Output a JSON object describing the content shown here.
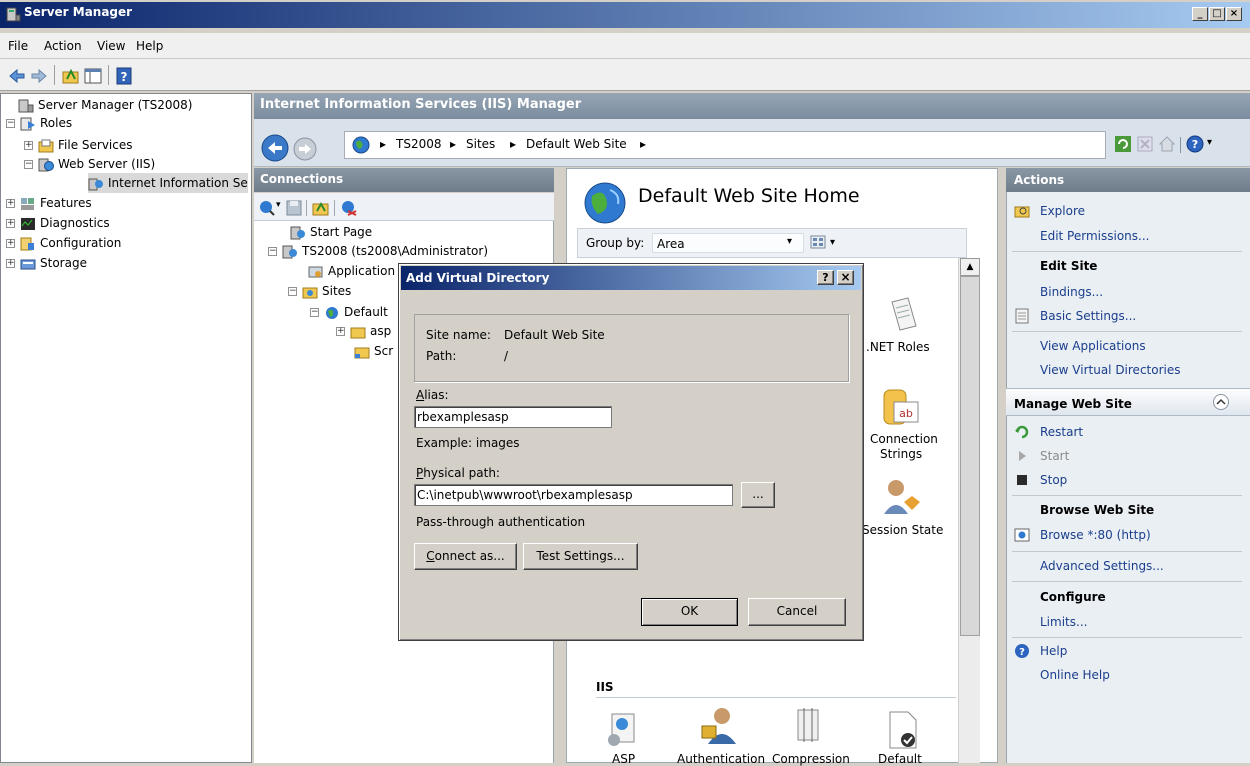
{
  "window": {
    "title": "Server Manager"
  },
  "menu": [
    "File",
    "Action",
    "View",
    "Help"
  ],
  "left_tree": {
    "root": "Server Manager (TS2008)",
    "roles": "Roles",
    "file_services": "File Services",
    "web_server": "Web Server (IIS)",
    "iis_manager": "Internet Information Se",
    "features": "Features",
    "diagnostics": "Diagnostics",
    "configuration": "Configuration",
    "storage": "Storage"
  },
  "iis": {
    "header": "Internet Information Services (IIS) Manager",
    "breadcrumb": [
      "TS2008",
      "Sites",
      "Default Web Site"
    ]
  },
  "connections": {
    "header": "Connections",
    "start_page": "Start Page",
    "server": "TS2008 (ts2008\\Administrator)",
    "app_pools": "Application",
    "sites": "Sites",
    "default_site": "Default",
    "child1": "asp",
    "child2": "Scr"
  },
  "center": {
    "title": "Default Web Site Home",
    "group_by_label": "Group by:",
    "group_by_value": "Area",
    "features": {
      "net_roles": ".NET Roles",
      "connection_strings": [
        "Connection",
        "Strings"
      ],
      "session_state": "Session State"
    },
    "iis_section": "IIS",
    "iis_features": [
      "ASP",
      "Authentication",
      "Compression",
      "Default"
    ]
  },
  "actions": {
    "header": "Actions",
    "explore": "Explore",
    "edit_permissions": "Edit Permissions...",
    "edit_site": "Edit Site",
    "bindings": "Bindings...",
    "basic_settings": "Basic Settings...",
    "view_applications": "View Applications",
    "view_virtual_dirs": "View Virtual Directories",
    "manage_site": "Manage Web Site",
    "restart": "Restart",
    "start": "Start",
    "stop": "Stop",
    "browse_site": "Browse Web Site",
    "browse": "Browse *:80 (http)",
    "advanced_settings": "Advanced Settings...",
    "configure": "Configure",
    "limits": "Limits...",
    "help": "Help",
    "online_help": "Online Help"
  },
  "dialog": {
    "title": "Add Virtual Directory",
    "site_name_label": "Site name:",
    "site_name_value": "Default Web Site",
    "path_label": "Path:",
    "path_value": "/",
    "alias_label_first": "A",
    "alias_label_rest": "lias:",
    "alias_value": "rbexamplesasp",
    "alias_example": "Example: images",
    "physical_label_first": "P",
    "physical_label_rest": "hysical path:",
    "physical_value": "C:\\inetpub\\wwwroot\\rbexamplesasp",
    "browse_btn": "...",
    "pass_through": "Pass-through authentication",
    "connect_as_first": "C",
    "connect_as_rest": "onnect as...",
    "test_settings": "Test Settings...",
    "ok": "OK",
    "cancel": "Cancel",
    "help_btn": "?",
    "close_btn": "×"
  }
}
